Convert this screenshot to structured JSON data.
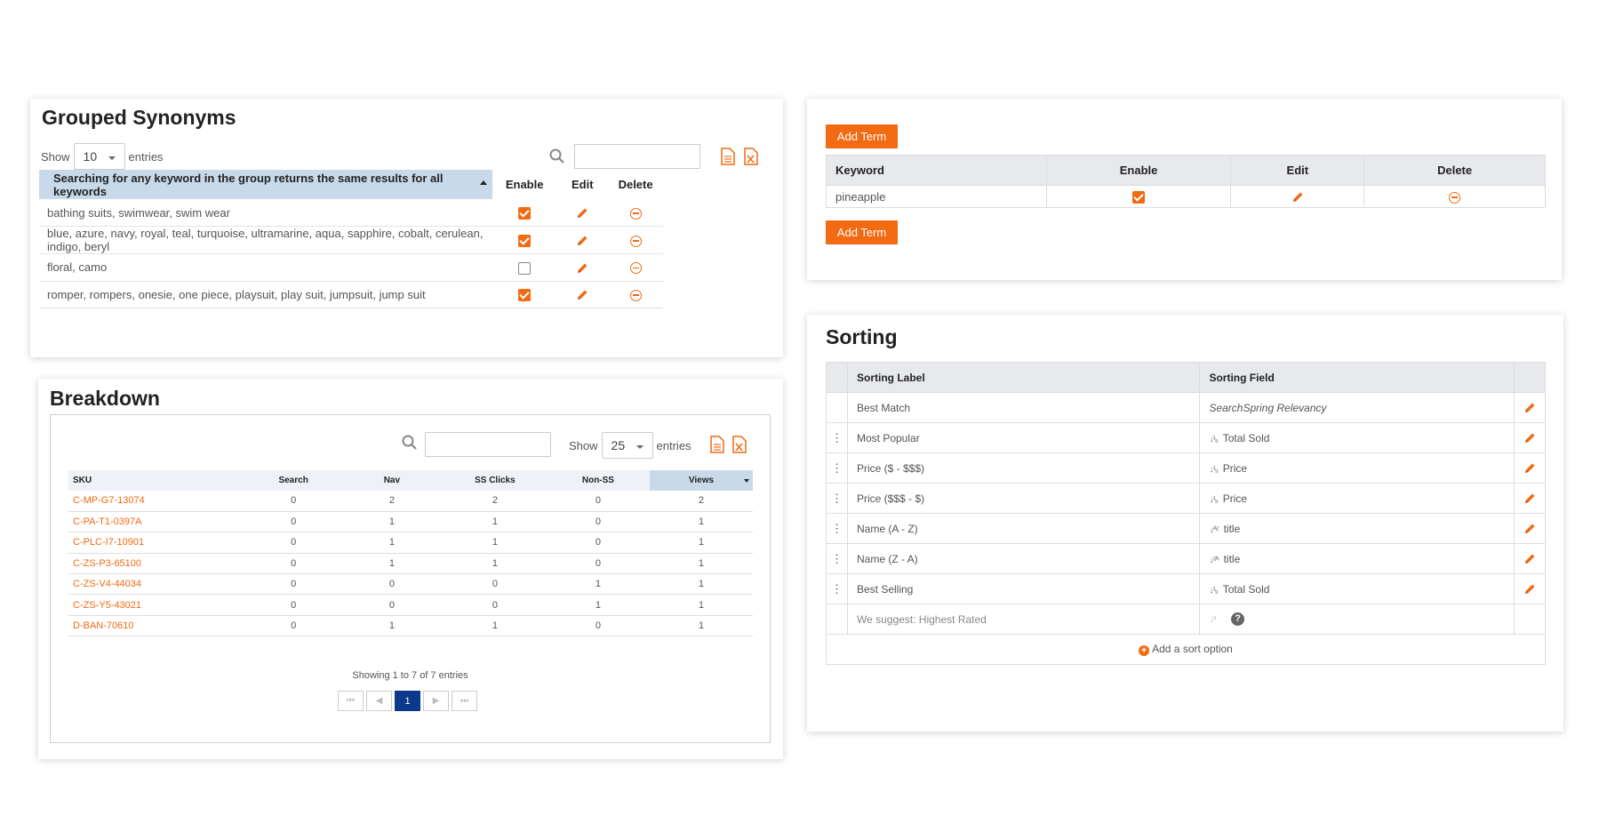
{
  "grouped_synonyms": {
    "title": "Grouped Synonyms",
    "show_label": "Show",
    "entries_value": "10",
    "entries_label": "entries",
    "columns": {
      "keywords": "Searching for any keyword in the group returns the same results for all keywords",
      "enable": "Enable",
      "edit": "Edit",
      "delete": "Delete"
    },
    "rows": [
      {
        "keywords": "bathing suits, swimwear, swim wear",
        "enabled": true
      },
      {
        "keywords": "blue, azure, navy, royal, teal, turquoise, ultramarine, aqua, sapphire, cobalt, cerulean, indigo, beryl",
        "enabled": true
      },
      {
        "keywords": "floral, camo",
        "enabled": false
      },
      {
        "keywords": "romper, rompers, onesie, one piece, playsuit, play suit, jumpsuit, jump suit",
        "enabled": true
      }
    ]
  },
  "add_term": {
    "button_label": "Add Term",
    "columns": {
      "keyword": "Keyword",
      "enable": "Enable",
      "edit": "Edit",
      "delete": "Delete"
    },
    "rows": [
      {
        "keyword": "pineapple",
        "enabled": true
      }
    ]
  },
  "breakdown": {
    "title": "Breakdown",
    "show_label": "Show",
    "entries_value": "25",
    "entries_label": "entries",
    "columns": {
      "sku": "SKU",
      "search": "Search",
      "nav": "Nav",
      "ss_clicks": "SS Clicks",
      "non_ss": "Non-SS",
      "views": "Views"
    },
    "rows": [
      {
        "sku": "C-MP-G7-13074",
        "search": "0",
        "nav": "2",
        "ss_clicks": "2",
        "non_ss": "0",
        "views": "2"
      },
      {
        "sku": "C-PA-T1-0397A",
        "search": "0",
        "nav": "1",
        "ss_clicks": "1",
        "non_ss": "0",
        "views": "1"
      },
      {
        "sku": "C-PLC-I7-10901",
        "search": "0",
        "nav": "1",
        "ss_clicks": "1",
        "non_ss": "0",
        "views": "1"
      },
      {
        "sku": "C-ZS-P3-65100",
        "search": "0",
        "nav": "1",
        "ss_clicks": "1",
        "non_ss": "0",
        "views": "1"
      },
      {
        "sku": "C-ZS-V4-44034",
        "search": "0",
        "nav": "0",
        "ss_clicks": "0",
        "non_ss": "1",
        "views": "1"
      },
      {
        "sku": "C-ZS-Y5-43021",
        "search": "0",
        "nav": "0",
        "ss_clicks": "0",
        "non_ss": "1",
        "views": "1"
      },
      {
        "sku": "D-BAN-70610",
        "search": "0",
        "nav": "1",
        "ss_clicks": "1",
        "non_ss": "0",
        "views": "1"
      }
    ],
    "info": "Showing 1 to 7 of 7 entries",
    "current_page": "1"
  },
  "sorting": {
    "title": "Sorting",
    "columns": {
      "label": "Sorting Label",
      "field": "Sorting Field"
    },
    "rows": [
      {
        "label": "Best Match",
        "field": "SearchSpring Relevancy",
        "icon": "",
        "draggable": false,
        "italic": true
      },
      {
        "label": "Most Popular",
        "field": "Total Sold",
        "icon": "sort-desc-numeric-icon",
        "draggable": true
      },
      {
        "label": "Price ($ - $$$)",
        "field": "Price",
        "icon": "sort-asc-numeric-icon",
        "draggable": true
      },
      {
        "label": "Price ($$$ - $)",
        "field": "Price",
        "icon": "sort-desc-numeric-icon",
        "draggable": true
      },
      {
        "label": "Name (A - Z)",
        "field": "title",
        "icon": "sort-asc-alpha-icon",
        "draggable": true
      },
      {
        "label": "Name (Z - A)",
        "field": "title",
        "icon": "sort-desc-alpha-icon",
        "draggable": true
      },
      {
        "label": "Best Selling",
        "field": "Total Sold",
        "icon": "sort-asc-numeric-icon",
        "draggable": true
      }
    ],
    "suggestion": "We suggest: Highest Rated",
    "add_option": "Add a sort option"
  },
  "colors": {
    "accent": "#f26a12",
    "header_blue": "#c8daea",
    "page_active": "#0b3a8c"
  }
}
